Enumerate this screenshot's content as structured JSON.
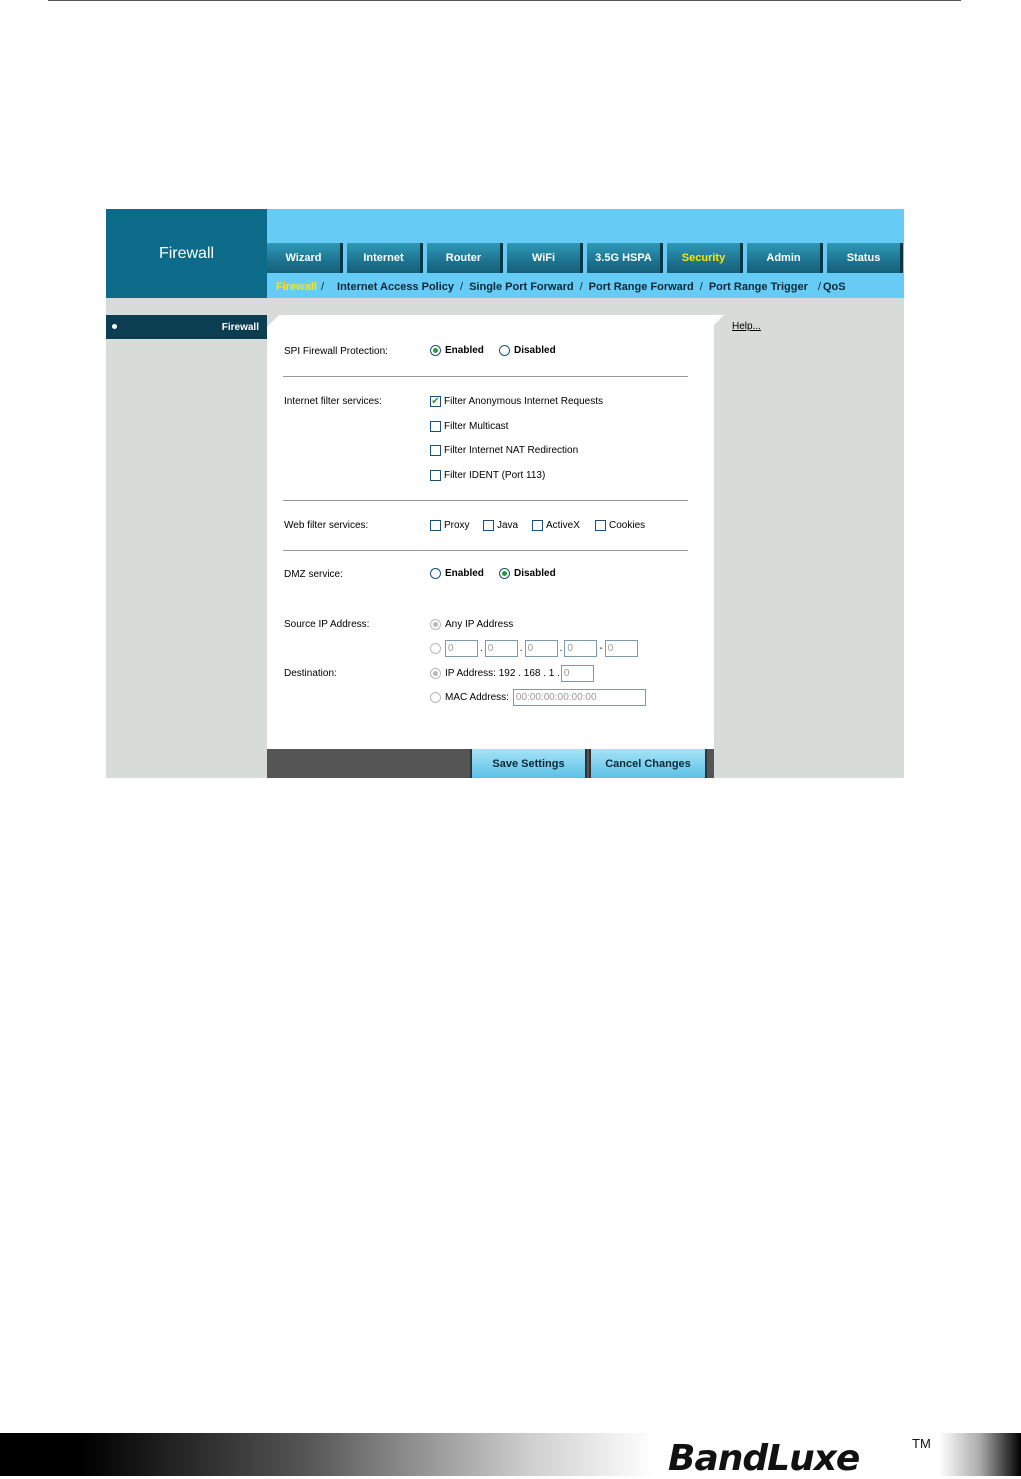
{
  "ui": {
    "brand": "Firewall",
    "tabs": [
      {
        "label": "Wizard"
      },
      {
        "label": "Internet"
      },
      {
        "label": "Router"
      },
      {
        "label": "WiFi"
      },
      {
        "label": "3.5G HSPA"
      },
      {
        "label": "Security"
      },
      {
        "label": "Admin"
      },
      {
        "label": "Status"
      }
    ],
    "active_tab": "Security",
    "subnav": {
      "current": "Firewall",
      "items": [
        "Internet Access Policy",
        "Single Port Forward",
        "Port Range Forward",
        "Port Range Trigger",
        "QoS"
      ]
    },
    "left_nav": {
      "item": "Firewall"
    },
    "help": "Help..."
  },
  "form": {
    "spi": {
      "label": "SPI Firewall Protection:",
      "enabled": "Enabled",
      "disabled": "Disabled",
      "value": "Enabled"
    },
    "internet_filter": {
      "label": "Internet filter services:",
      "options": [
        {
          "label": "Filter Anonymous Internet Requests",
          "checked": true
        },
        {
          "label": "Filter Multicast",
          "checked": false
        },
        {
          "label": "Filter Internet NAT Redirection",
          "checked": false
        },
        {
          "label": "Filter IDENT (Port 113)",
          "checked": false
        }
      ]
    },
    "web_filter": {
      "label": "Web filter services:",
      "options": [
        {
          "label": "Proxy",
          "checked": false
        },
        {
          "label": "Java",
          "checked": false
        },
        {
          "label": "ActiveX",
          "checked": false
        },
        {
          "label": "Cookies",
          "checked": false
        }
      ]
    },
    "dmz": {
      "label": "DMZ service:",
      "enabled": "Enabled",
      "disabled": "Disabled",
      "value": "Disabled"
    },
    "source_ip": {
      "label": "Source IP Address:",
      "any": "Any IP Address",
      "range": [
        "0",
        "0",
        "0",
        "0",
        "0"
      ],
      "dash": "-"
    },
    "destination": {
      "label": "Destination:",
      "ip_label": "IP Address: 192 . 168 . 1 .",
      "ip_last": "0",
      "mac_label": "MAC Address:",
      "mac_value": "00:00:00:00:00:00"
    }
  },
  "buttons": {
    "save": "Save Settings",
    "cancel": "Cancel Changes"
  },
  "brand_logo": {
    "text": "BandLuxe",
    "tm": "TM"
  }
}
